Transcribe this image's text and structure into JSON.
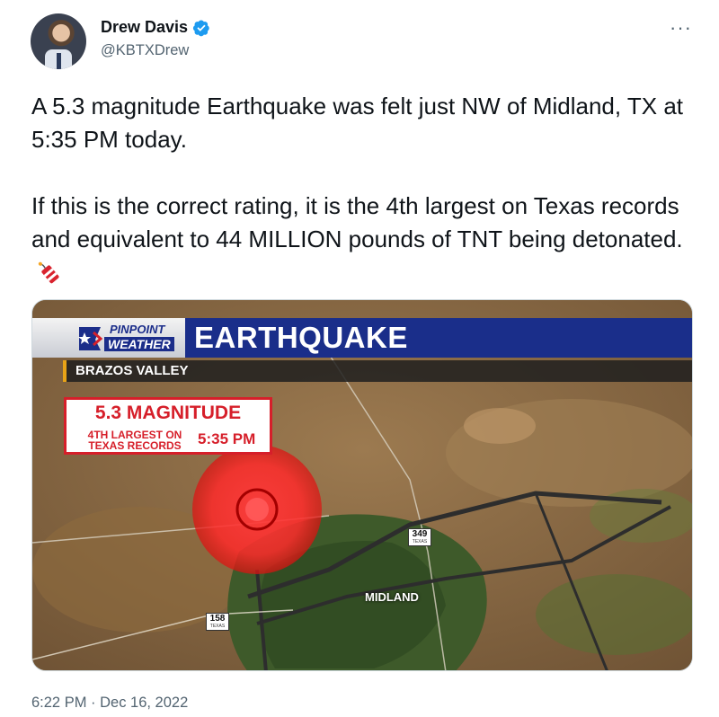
{
  "author": {
    "name": "Drew Davis",
    "handle": "@KBTXDrew",
    "verified": true
  },
  "tweet": {
    "paragraph1": "A 5.3 magnitude Earthquake was felt just NW of Midland, TX at 5:35 PM today.",
    "paragraph2": "If this is the correct rating, it is the 4th largest on Texas records and equivalent to 44 MILLION pounds of TNT being detonated.",
    "emoji": "firecracker-icon"
  },
  "media": {
    "logo_top": "PINPOINT",
    "logo_bottom": "WEATHER",
    "headline": "EARTHQUAKE",
    "region": "BRAZOS VALLEY",
    "magnitude": "5.3 MAGNITUDE",
    "rank": "4TH LARGEST ON TEXAS RECORDS",
    "time": "5:35 PM",
    "city": "MIDLAND",
    "route_349": "349",
    "route_158": "158",
    "shield_state": "TEXAS"
  },
  "footer": {
    "timestamp": "6:22 PM · Dec 16, 2022"
  },
  "colors": {
    "verified": "#1d9bf0",
    "alert_red": "#d61f2a",
    "graphic_blue": "#1a2e8a"
  }
}
